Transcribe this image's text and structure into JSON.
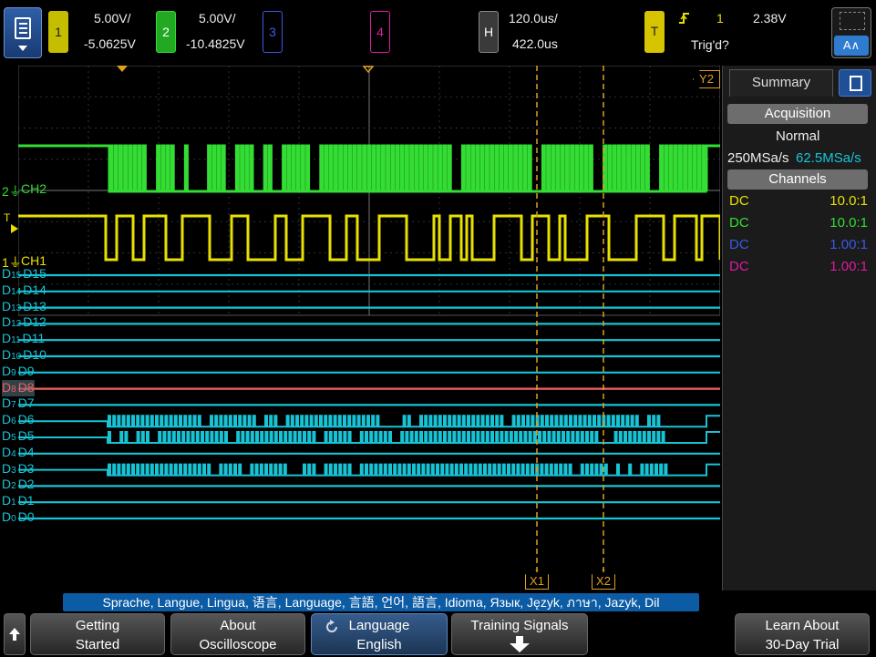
{
  "topbar": {
    "ch1": {
      "num": "1",
      "scale": "5.00V/",
      "offset": "-5.0625V",
      "color": "#e8e000"
    },
    "ch2": {
      "num": "2",
      "scale": "5.00V/",
      "offset": "-10.4825V",
      "color": "#33dd33"
    },
    "ch3": {
      "num": "3",
      "color": "#3a5ae8"
    },
    "ch4": {
      "num": "4",
      "color": "#e01aa0"
    },
    "horiz": {
      "key": "H",
      "timebase": "120.0us/",
      "delay": "422.0us"
    },
    "trigger": {
      "key": "T",
      "source": "1",
      "level": "2.38V",
      "status": "Trig'd?",
      "edge_icon": "rising-edge-icon"
    },
    "auto_label": "A∧"
  },
  "markers": {
    "y2": "Y2",
    "x1": "X1",
    "x2": "X2",
    "t": "T"
  },
  "analog_labels": {
    "ch2": "CH2",
    "ch1": "CH1",
    "ch2_gnd": "2",
    "ch1_gnd": "1"
  },
  "digital_channels": [
    {
      "label": "D15",
      "sub": "15"
    },
    {
      "label": "D14",
      "sub": "14"
    },
    {
      "label": "D13",
      "sub": "13"
    },
    {
      "label": "D12",
      "sub": "12"
    },
    {
      "label": "D11",
      "sub": "11"
    },
    {
      "label": "D10",
      "sub": "10"
    },
    {
      "label": "D9",
      "sub": "9"
    },
    {
      "label": "D8",
      "sub": "8"
    },
    {
      "label": "D7",
      "sub": "7"
    },
    {
      "label": "D6",
      "sub": "6"
    },
    {
      "label": "D5",
      "sub": "5"
    },
    {
      "label": "D4",
      "sub": "4"
    },
    {
      "label": "D3",
      "sub": "3"
    },
    {
      "label": "D2",
      "sub": "2"
    },
    {
      "label": "D1",
      "sub": "1"
    },
    {
      "label": "D0",
      "sub": "0"
    }
  ],
  "panel": {
    "tab_label": "Summary",
    "acquisition": {
      "header": "Acquisition",
      "mode": "Normal",
      "rate1": "250MSa/s",
      "rate2": "62.5MSa/s"
    },
    "channels": {
      "header": "Channels",
      "rows": [
        {
          "coupling": "DC",
          "probe": "10.0:1",
          "color": "#e8e000"
        },
        {
          "coupling": "DC",
          "probe": "10.0:1",
          "color": "#33dd33"
        },
        {
          "coupling": "DC",
          "probe": "1.00:1",
          "color": "#3a5ae8"
        },
        {
          "coupling": "DC",
          "probe": "1.00:1",
          "color": "#e01aa0"
        }
      ]
    }
  },
  "language_bar": "Sprache, Langue, Lingua, 语言, Language, 言語, 언어, 語言, Idioma, Язык, Język, ภาษา, Jazyk, Dil",
  "softkeys": {
    "getting_started": {
      "l1": "Getting",
      "l2": "Started"
    },
    "about": {
      "l1": "About",
      "l2": "Oscilloscope"
    },
    "language": {
      "l1": "Language",
      "l2": "English"
    },
    "training": {
      "l1": "Training Signals"
    },
    "trial": {
      "l1": "Learn About",
      "l2": "30-Day Trial"
    }
  },
  "colors": {
    "ch1": "#e8e000",
    "ch2": "#33dd33",
    "digital": "#17c4d6",
    "d8": "#f06060",
    "cursor": "#e0a020"
  }
}
